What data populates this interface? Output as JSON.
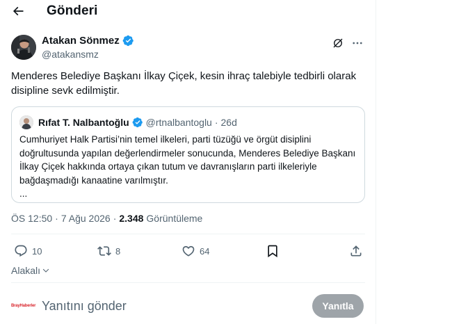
{
  "header": {
    "title": "Gönderi",
    "back_icon": "arrow-left-icon"
  },
  "post": {
    "author": {
      "name": "Atakan Sönmez",
      "handle": "@atakansmz",
      "verified": true,
      "verified_color": "#1d9bf0"
    },
    "text": "Menderes Belediye Başkanı İlkay Çiçek, kesin ihraç talebiyle tedbirli olarak disipline sevk edilmiştir.",
    "quote": {
      "name": "Rıfat T. Nalbantoğlu",
      "handle": "@rtnalbantoglu",
      "dot": "·",
      "time": "26d",
      "text": "Cumhuriyet Halk Partisi’nin temel ilkeleri, parti tüzüğü ve örgüt disiplini doğrultusunda yapılan değerlendirmeler sonucunda, Menderes Belediye Başkanı İlkay Çiçek hakkında ortaya çıkan tutum ve davranışların parti ilkeleriyle bağdaşmadığı kanaatine varılmıştır.",
      "ellipsis": "..."
    },
    "meta": {
      "time": "ÖS 12:50",
      "dot": "·",
      "date": "7 Ağu 2026",
      "dot2": "·",
      "views": "2.348",
      "views_label": "Görüntüleme"
    },
    "actions": {
      "replies": "10",
      "reposts": "8",
      "likes": "64"
    },
    "reply_settings": "Alakalı"
  },
  "reply": {
    "placeholder": "Yanıtını gönder",
    "button": "Yanıtla",
    "avatar_logo": "BrayHaberler"
  },
  "colors": {
    "accent": "#1d9bf0",
    "text": "#0f1419",
    "muted": "#536471",
    "border": "#cfd9de",
    "reply_button": "#8e959b",
    "logo_red": "#d9272e"
  }
}
